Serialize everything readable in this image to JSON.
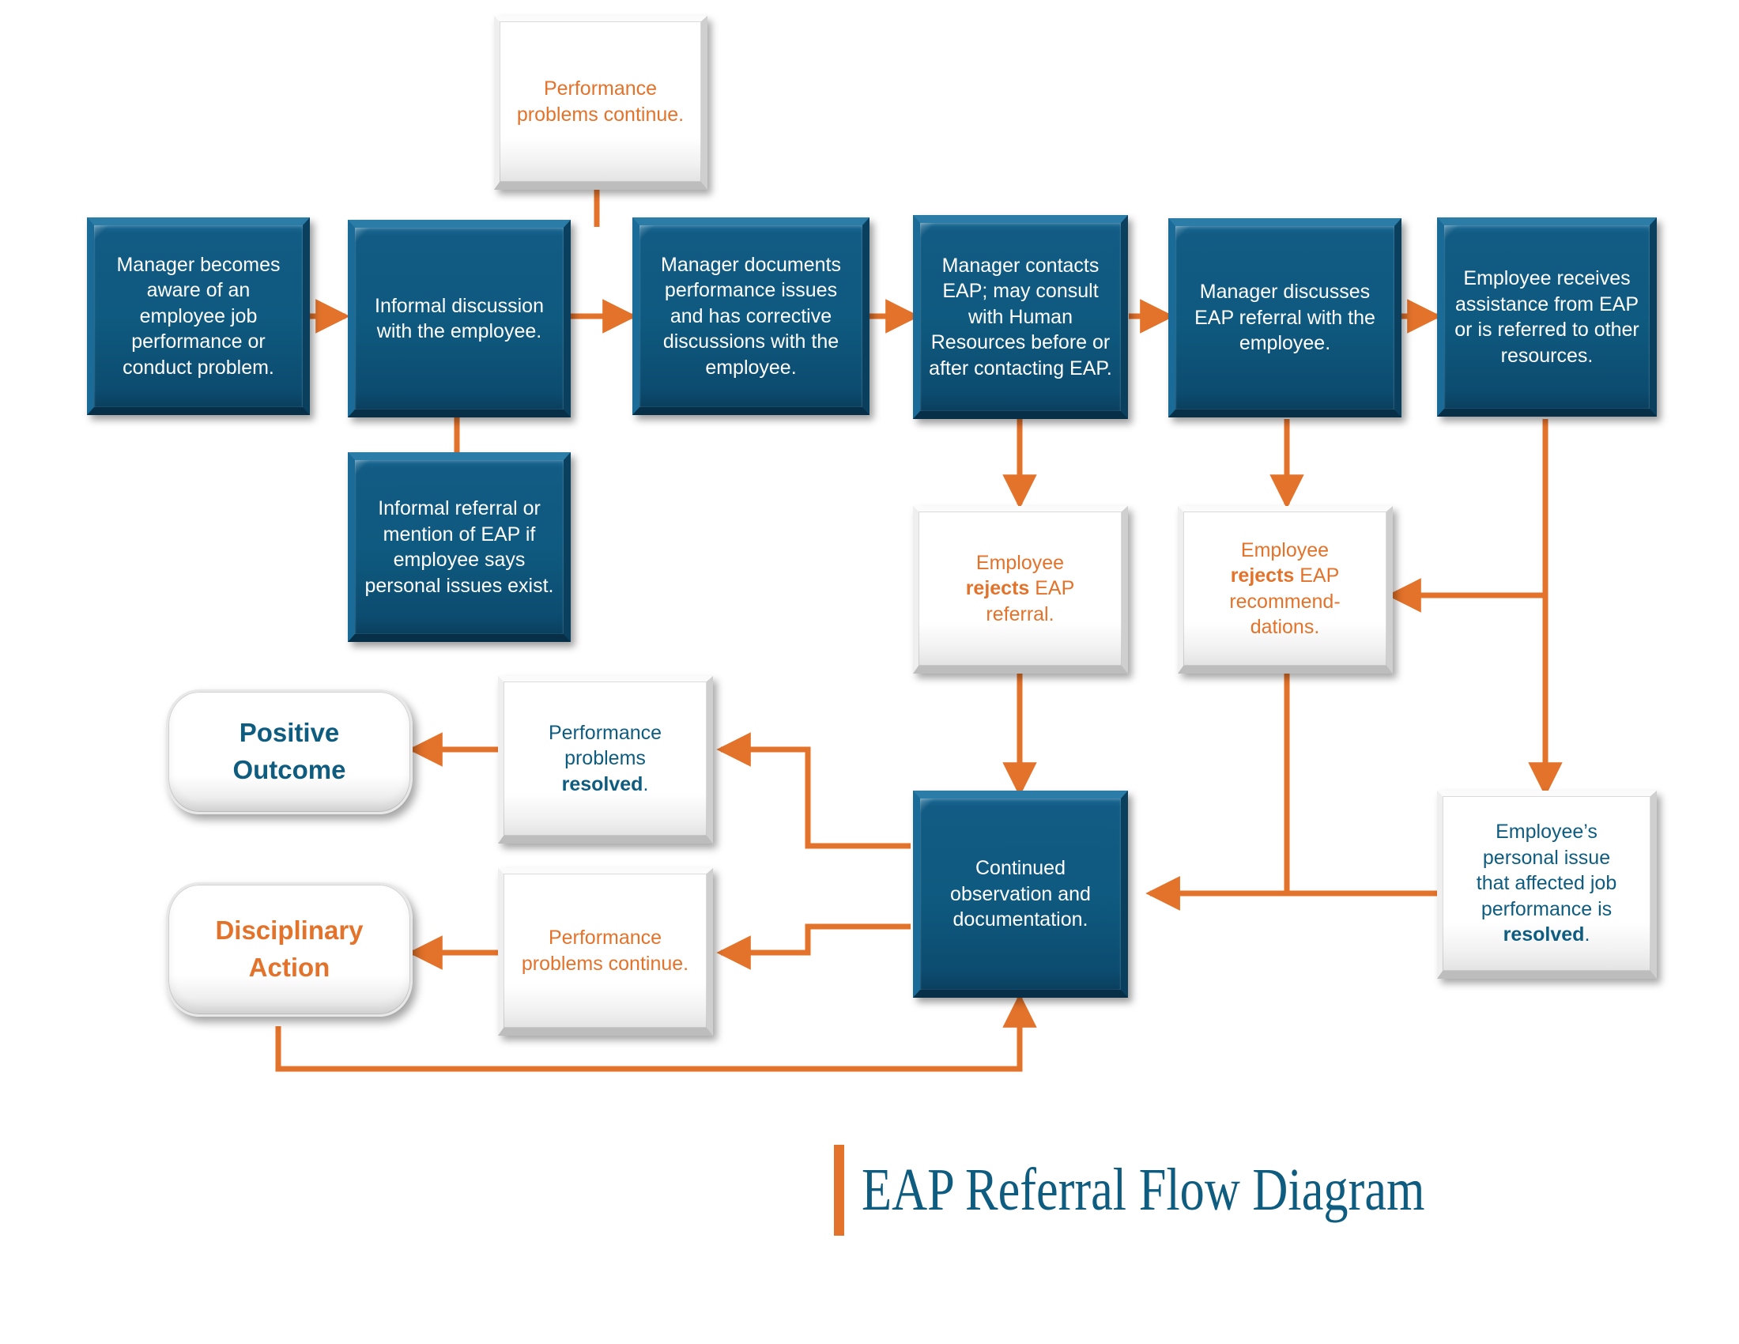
{
  "title": {
    "text": "EAP Referral Flow Diagram",
    "accent_color": "#E3722A",
    "text_color": "#0E5C80"
  },
  "colors": {
    "process_fill": "#0F5A80",
    "process_text": "#FFFFFF",
    "connector": "#E3722A",
    "note_text_orange": "#E3722A",
    "note_text_blue": "#0E5C80",
    "note_fill": "#FFFFFF"
  },
  "nodes": {
    "performance_problems_continue_top": {
      "text": "Performance problems continue.",
      "style": "white-orange"
    },
    "manager_becomes_aware": {
      "text": "Manager becomes aware of an employee job performance or conduct problem.",
      "style": "blue"
    },
    "informal_discussion": {
      "text": "Informal discussion with the employee.",
      "style": "blue"
    },
    "manager_documents": {
      "text": "Manager documents performance issues and has corrective discussions with the employee.",
      "style": "blue"
    },
    "manager_contacts_eap": {
      "text": "Manager contacts EAP; may consult with Human Resources before or after contacting EAP.",
      "style": "blue"
    },
    "manager_discusses_referral": {
      "text": "Manager discusses EAP referral with the employee.",
      "style": "blue"
    },
    "employee_receives_assistance": {
      "text": "Employee receives assistance from EAP or is referred to other resources.",
      "style": "blue"
    },
    "informal_referral": {
      "text": "Informal referral or mention of EAP if employee says personal issues exist.",
      "style": "blue"
    },
    "rejects_referral": {
      "line1": "Employee",
      "bold": "rejects",
      "line2": " EAP",
      "line3": "referral.",
      "style": "white-orange"
    },
    "rejects_recommendations": {
      "line1": "Employee",
      "bold": "rejects",
      "line2": " EAP",
      "line3": "recommend-",
      "line4": "dations.",
      "style": "white-orange"
    },
    "continued_observation": {
      "text": "Continued observation and documentation.",
      "style": "blue"
    },
    "problems_resolved": {
      "line1": "Performance",
      "line2": "problems",
      "bold": "resolved",
      "line3": ".",
      "style": "white-blue"
    },
    "problems_continue": {
      "text": "Performance problems continue.",
      "style": "white-orange"
    },
    "personal_issue_resolved": {
      "line1": "Employee’s",
      "line2": "personal issue",
      "line3": "that affected job",
      "line4": "performance is",
      "bold": "resolved",
      "line5": ".",
      "style": "white-blue"
    },
    "positive_outcome": {
      "line1": "Positive",
      "line2": "Outcome",
      "style": "terminator-blue"
    },
    "disciplinary_action": {
      "line1": "Disciplinary",
      "line2": "Action",
      "style": "terminator-orange"
    }
  }
}
